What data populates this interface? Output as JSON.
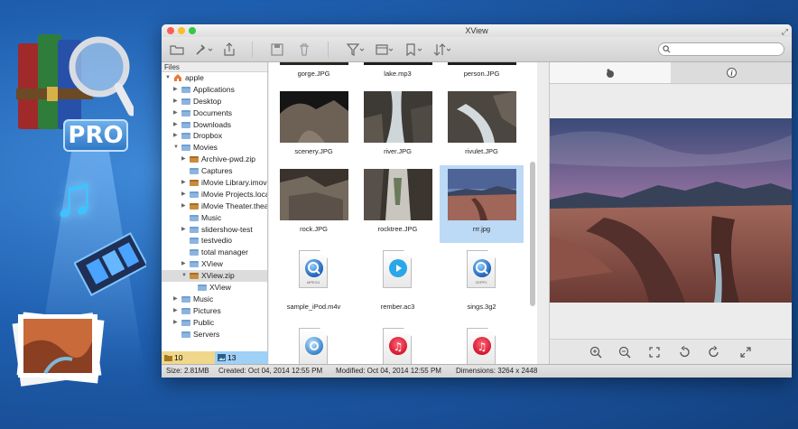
{
  "window": {
    "title": "XView"
  },
  "search": {
    "placeholder": ""
  },
  "sidebar": {
    "header": "Files",
    "tree": [
      {
        "label": "apple",
        "depth": 0,
        "expanded": true,
        "icon": "home-icon"
      },
      {
        "label": "Applications",
        "depth": 1,
        "expanded": false,
        "icon": "folder-icon"
      },
      {
        "label": "Desktop",
        "depth": 1,
        "expanded": false,
        "icon": "folder-icon"
      },
      {
        "label": "Documents",
        "depth": 1,
        "expanded": false,
        "icon": "folder-icon"
      },
      {
        "label": "Downloads",
        "depth": 1,
        "expanded": false,
        "icon": "folder-icon"
      },
      {
        "label": "Dropbox",
        "depth": 1,
        "expanded": false,
        "icon": "folder-icon"
      },
      {
        "label": "Movies",
        "depth": 1,
        "expanded": true,
        "icon": "folder-icon"
      },
      {
        "label": "Archive-pwd.zip",
        "depth": 2,
        "expanded": false,
        "icon": "zip-icon"
      },
      {
        "label": "Captures",
        "depth": 2,
        "expanded": null,
        "icon": "folder-icon"
      },
      {
        "label": "iMovie Library.imov",
        "depth": 2,
        "expanded": false,
        "icon": "zip-icon"
      },
      {
        "label": "iMovie Projects.loca",
        "depth": 2,
        "expanded": false,
        "icon": "folder-icon"
      },
      {
        "label": "iMovie Theater.thea",
        "depth": 2,
        "expanded": false,
        "icon": "zip-icon"
      },
      {
        "label": "Music",
        "depth": 2,
        "expanded": null,
        "icon": "folder-icon"
      },
      {
        "label": "slidershow-test",
        "depth": 2,
        "expanded": false,
        "icon": "folder-icon"
      },
      {
        "label": "testvedio",
        "depth": 2,
        "expanded": null,
        "icon": "folder-icon"
      },
      {
        "label": "total manager",
        "depth": 2,
        "expanded": null,
        "icon": "folder-icon"
      },
      {
        "label": "XView",
        "depth": 2,
        "expanded": false,
        "icon": "folder-icon"
      },
      {
        "label": "XView.zip",
        "depth": 2,
        "expanded": true,
        "icon": "zip-icon",
        "selected": true
      },
      {
        "label": "XView",
        "depth": 3,
        "expanded": null,
        "icon": "folder-icon"
      },
      {
        "label": "Music",
        "depth": 1,
        "expanded": false,
        "icon": "folder-icon"
      },
      {
        "label": "Pictures",
        "depth": 1,
        "expanded": false,
        "icon": "folder-icon"
      },
      {
        "label": "Public",
        "depth": 1,
        "expanded": false,
        "icon": "folder-icon"
      },
      {
        "label": "Servers",
        "depth": 1,
        "expanded": null,
        "icon": "folder-icon"
      }
    ],
    "footer": {
      "folders_count": "10",
      "images_count": "13"
    }
  },
  "grid": {
    "items": [
      {
        "name": "gorge.JPG",
        "kind": "image",
        "scene": "rock-dark"
      },
      {
        "name": "lake.mp3",
        "kind": "image",
        "scene": "dark"
      },
      {
        "name": "person.JPG",
        "kind": "image",
        "scene": "dark"
      },
      {
        "name": "scenery.JPG",
        "kind": "image",
        "scene": "cave"
      },
      {
        "name": "river.JPG",
        "kind": "image",
        "scene": "waterfall"
      },
      {
        "name": "rivulet.JPG",
        "kind": "image",
        "scene": "stream"
      },
      {
        "name": "rock.JPG",
        "kind": "image",
        "scene": "rock"
      },
      {
        "name": "rocktree.JPG",
        "kind": "image",
        "scene": "rocktree"
      },
      {
        "name": "rrr.jpg",
        "kind": "image",
        "scene": "canyon",
        "selected": true
      },
      {
        "name": "sample_iPod.m4v",
        "kind": "quicktime",
        "badge": "MPEG4"
      },
      {
        "name": "rember.ac3",
        "kind": "play",
        "badge": ""
      },
      {
        "name": "sings.3g2",
        "kind": "quicktime",
        "badge": "3GPP2"
      },
      {
        "name": "",
        "kind": "audio-q",
        "badge": ""
      },
      {
        "name": "",
        "kind": "itunes",
        "badge": ""
      },
      {
        "name": "",
        "kind": "itunes",
        "badge": ""
      }
    ]
  },
  "statusbar": {
    "size": "Size: 2.81MB",
    "created": "Created: Oct 04, 2014 12:55 PM",
    "modified": "Modified: Oct 04, 2014 12:55 PM",
    "dimensions": "Dimensions: 3264 x 2448"
  },
  "colors": {
    "accent": "#bcd9f6",
    "titlebar": "#dedede",
    "brand": "#1f5fb0"
  }
}
